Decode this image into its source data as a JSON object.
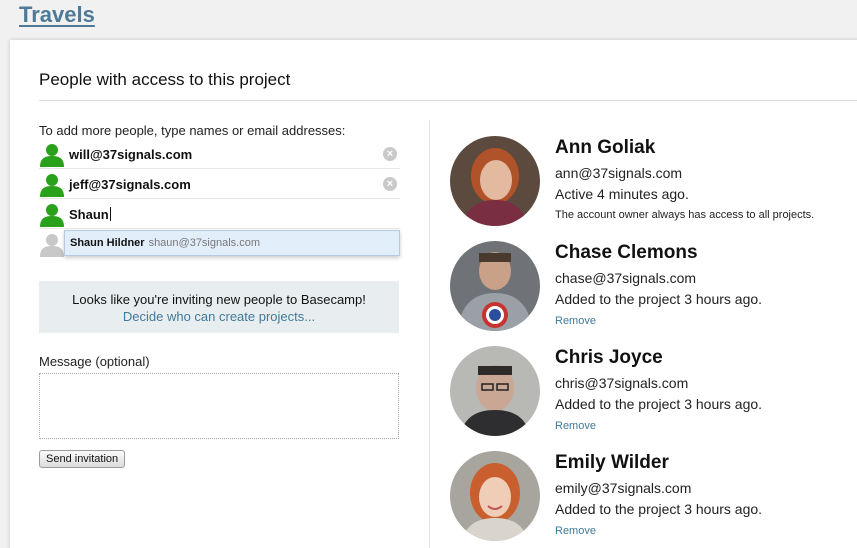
{
  "project": {
    "title": "Travels"
  },
  "access": {
    "title": "People with access to this project",
    "instructions": "To add more people, type names or email addresses:",
    "entries": [
      {
        "text": "will@37signals.com",
        "removable": true
      },
      {
        "text": "jeff@37signals.com",
        "removable": true
      },
      {
        "text": "Shaun",
        "removable": false
      }
    ],
    "remove_glyph": "×",
    "autocomplete": {
      "name": "Shaun Hildner",
      "email": "shaun@37signals.com"
    },
    "notice": {
      "text": "Looks like you're inviting new people to Basecamp!",
      "link": "Decide who can create projects..."
    },
    "message_label": "Message (optional)",
    "send_label": "Send invitation"
  },
  "members": [
    {
      "name": "Ann Goliak",
      "email": "ann@37signals.com",
      "status": "Active 4 minutes ago.",
      "note": "The account owner always has access to all projects."
    },
    {
      "name": "Chase Clemons",
      "email": "chase@37signals.com",
      "status": "Added to the project 3 hours ago.",
      "action": "Remove"
    },
    {
      "name": "Chris Joyce",
      "email": "chris@37signals.com",
      "status": "Added to the project 3 hours ago.",
      "action": "Remove"
    },
    {
      "name": "Emily Wilder",
      "email": "emily@37signals.com",
      "status": "Added to the project 3 hours ago.",
      "action": "Remove"
    }
  ],
  "colors": {
    "accent": "#40799a",
    "title": "#4d7a96",
    "person_green": "#2aa11a",
    "person_gray": "#c8c8c8"
  },
  "icons": [
    "person-icon",
    "remove-icon"
  ]
}
